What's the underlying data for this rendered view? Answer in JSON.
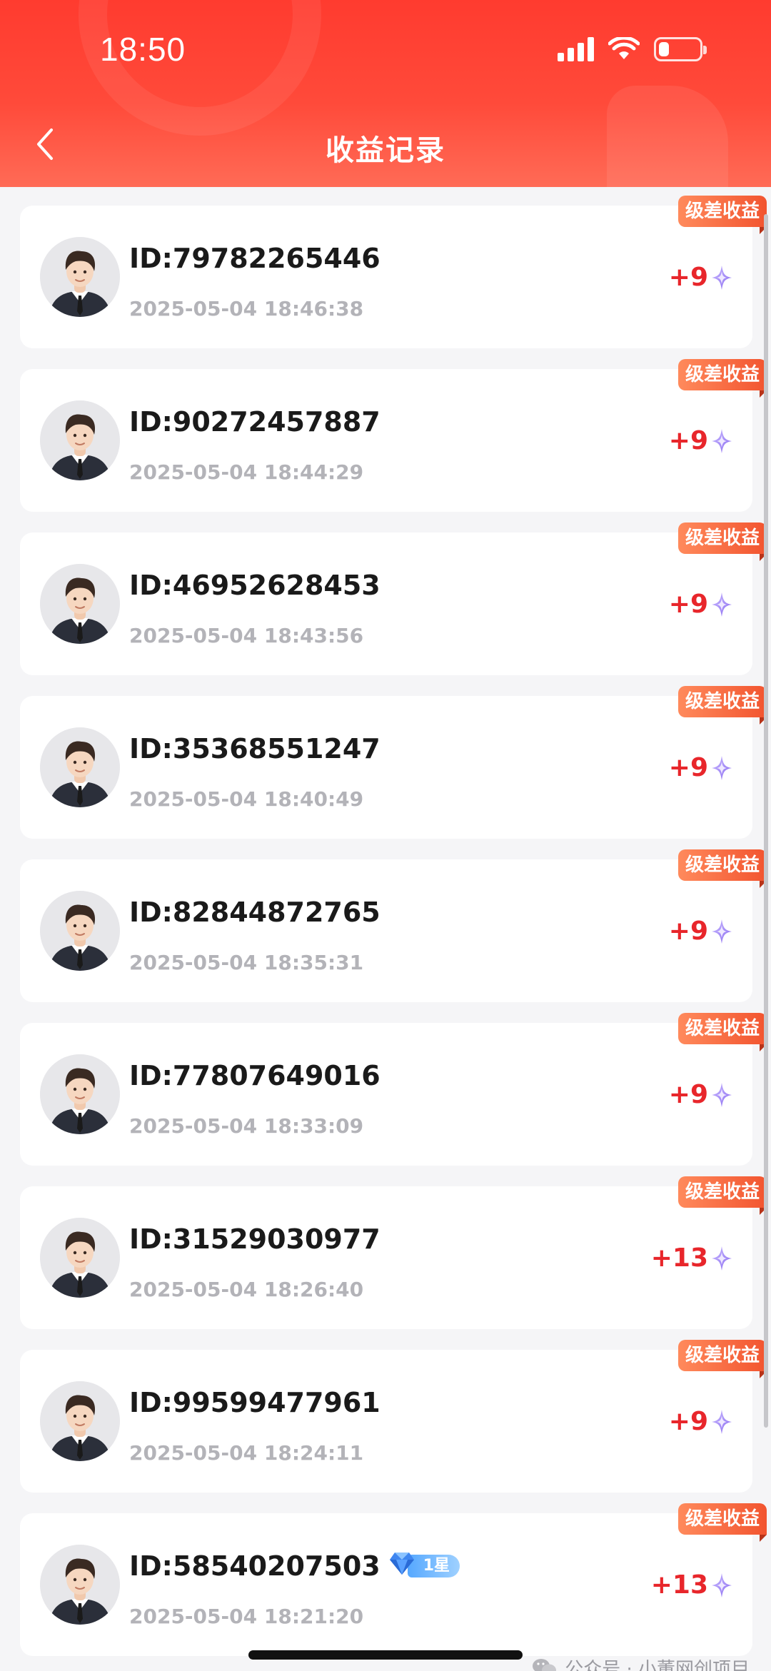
{
  "status_bar": {
    "time": "18:50",
    "battery_level": 0.25
  },
  "header": {
    "title": "收益记录",
    "back_icon": "chevron-left-icon"
  },
  "colors": {
    "header": "#ff3b2f",
    "amount": "#e8262b",
    "tag": "#f2542f"
  },
  "records": [
    {
      "id": "ID:79782265446",
      "time": "2025-05-04 18:46:38",
      "amount": "+9",
      "tag": "级差收益"
    },
    {
      "id": "ID:90272457887",
      "time": "2025-05-04 18:44:29",
      "amount": "+9",
      "tag": "级差收益"
    },
    {
      "id": "ID:46952628453",
      "time": "2025-05-04 18:43:56",
      "amount": "+9",
      "tag": "级差收益"
    },
    {
      "id": "ID:35368551247",
      "time": "2025-05-04 18:40:49",
      "amount": "+9",
      "tag": "级差收益"
    },
    {
      "id": "ID:82844872765",
      "time": "2025-05-04 18:35:31",
      "amount": "+9",
      "tag": "级差收益"
    },
    {
      "id": "ID:77807649016",
      "time": "2025-05-04 18:33:09",
      "amount": "+9",
      "tag": "级差收益"
    },
    {
      "id": "ID:31529030977",
      "time": "2025-05-04 18:26:40",
      "amount": "+13",
      "tag": "级差收益"
    },
    {
      "id": "ID:99599477961",
      "time": "2025-05-04 18:24:11",
      "amount": "+9",
      "tag": "级差收益"
    },
    {
      "id": "ID:58540207503",
      "time": "2025-05-04 18:21:20",
      "amount": "+13",
      "tag": "级差收益",
      "level": "1星"
    }
  ],
  "watermark": "公众号 · 小董网创项目"
}
